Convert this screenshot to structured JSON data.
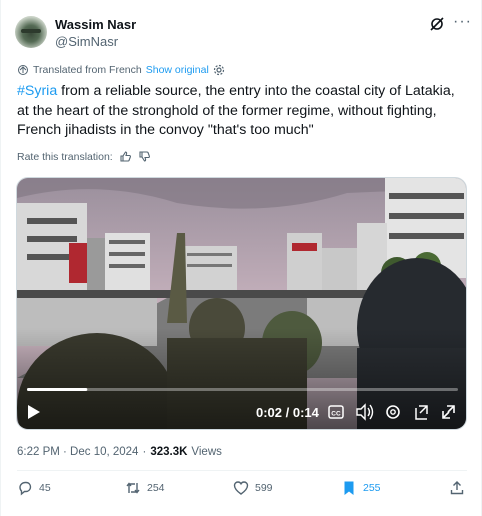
{
  "author": {
    "name": "Wassim Nasr",
    "handle": "@SimNasr"
  },
  "translation": {
    "label": "Translated from French",
    "show_original": "Show original"
  },
  "tweet": {
    "hashtag": "#Syria",
    "text": " from a reliable source, the entry into the coastal city of Latakia, at the heart of the stronghold of the former regime, without fighting, French jihadists in the convoy \"that's too much\""
  },
  "rate": {
    "label": "Rate this translation:"
  },
  "video": {
    "time_current": "0:02",
    "time_separator": " / ",
    "time_total": "0:14",
    "progress_fraction": 0.14
  },
  "meta": {
    "timestamp": "6:22 PM · Dec 10, 2024",
    "separator": "·",
    "views_count": "323.3K",
    "views_label": "Views"
  },
  "actions": {
    "replies": "45",
    "reposts": "254",
    "likes": "599",
    "bookmarks": "255"
  },
  "colors": {
    "accent": "#1d9bf0",
    "text": "#0f1419",
    "muted": "#536471"
  }
}
